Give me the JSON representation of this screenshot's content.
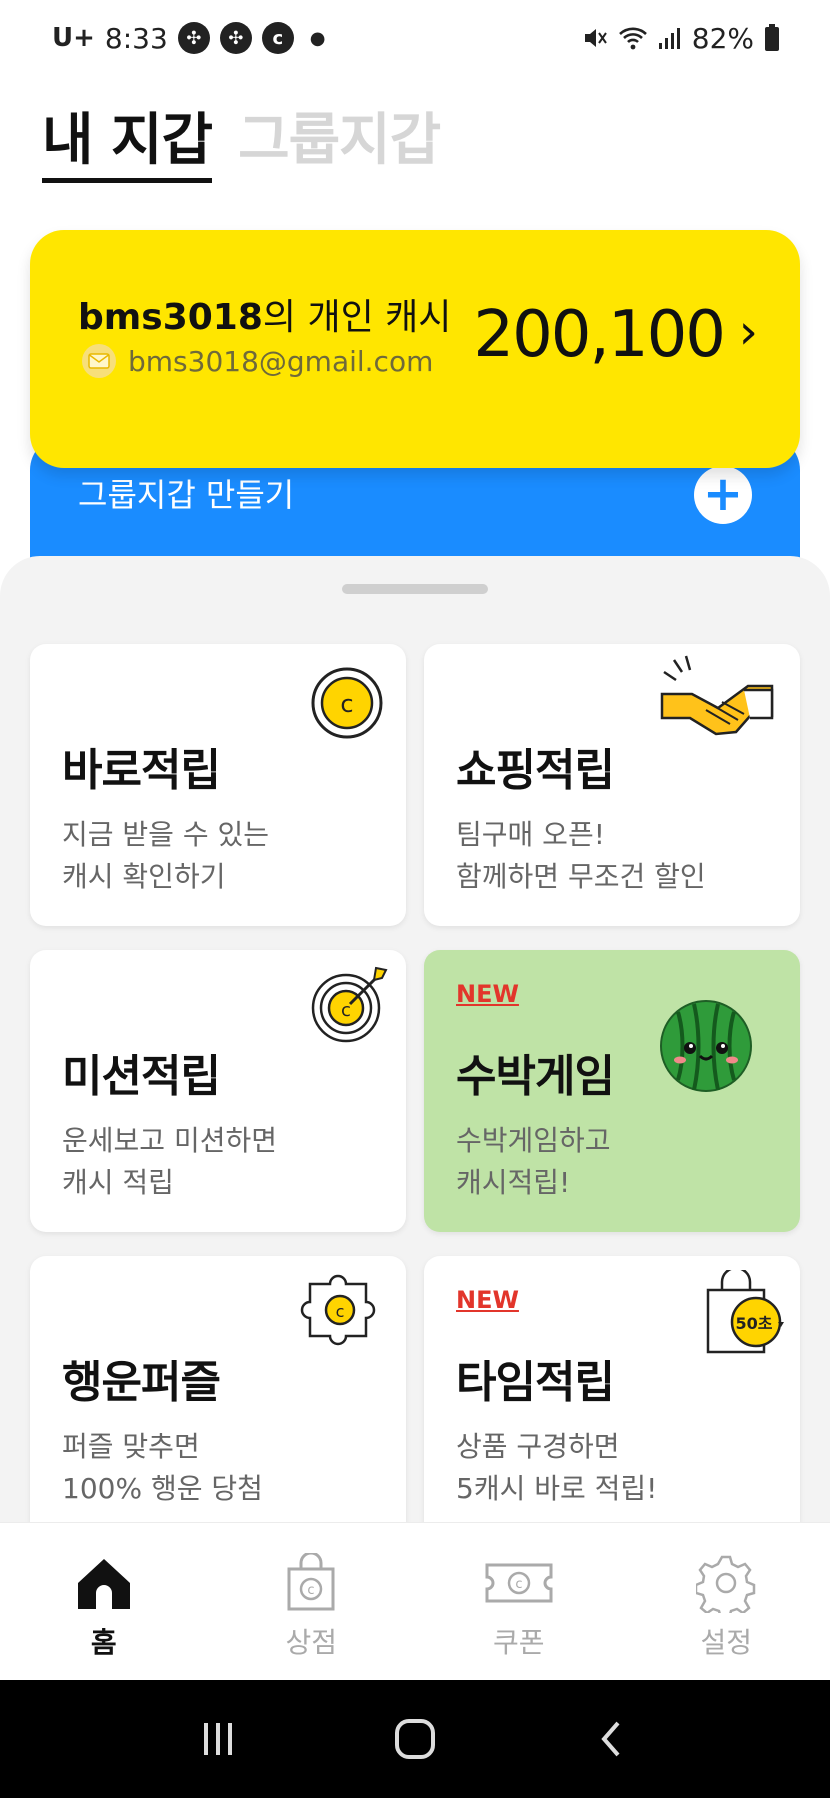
{
  "status_bar": {
    "carrier": "U+",
    "time": "8:33",
    "battery": "82%"
  },
  "wallet_tabs": {
    "my_wallet": "내 지갑",
    "group_wallet": "그룹지갑"
  },
  "cash_card": {
    "username": "bms3018",
    "owner_suffix": "의 개인 캐시",
    "email": "bms3018@gmail.com",
    "amount": "200,100",
    "chevron": "›",
    "color": "#ffe600"
  },
  "group_card": {
    "label": "그룹지갑 만들기",
    "plus": "+",
    "color": "#1a8cff"
  },
  "cards": [
    {
      "title": "바로적립",
      "subtitle": "지금 받을 수 있는\n캐시 확인하기",
      "icon": "coin-icon"
    },
    {
      "title": "쇼핑적립",
      "subtitle": "팀구매 오픈!\n함께하면 무조건 할인",
      "icon": "handshake-icon"
    },
    {
      "title": "미션적립",
      "subtitle": "운세보고 미션하면\n캐시 적립",
      "icon": "target-icon"
    },
    {
      "title": "수박게임",
      "subtitle": "수박게임하고\n캐시적립!",
      "badge": "NEW",
      "icon": "watermelon-icon",
      "bg": "#bfe3a6"
    },
    {
      "title": "행운퍼즐",
      "subtitle": "퍼즐 맞추면\n100% 행운 당첨",
      "icon": "puzzle-icon"
    },
    {
      "title": "타임적립",
      "subtitle": "상품 구경하면\n5캐시 바로 적립!",
      "badge": "NEW",
      "icon": "shopping-bag-timer-icon",
      "timer_label": "50초"
    }
  ],
  "bottom_nav": [
    {
      "label": "홈",
      "icon": "home-icon",
      "active": true
    },
    {
      "label": "상점",
      "icon": "store-bag-icon"
    },
    {
      "label": "쿠폰",
      "icon": "coupon-icon"
    },
    {
      "label": "설정",
      "icon": "gear-icon"
    }
  ]
}
